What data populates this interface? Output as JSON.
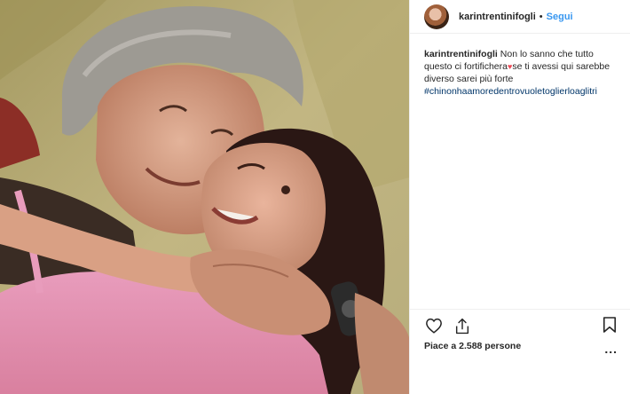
{
  "header": {
    "username": "karintrentinifogli",
    "separator": "•",
    "follow_label": "Segui"
  },
  "caption": {
    "username": "karintrentinifogli",
    "text_part1": "Non lo sanno che tutto questo ci fortifichera",
    "emoji": "♥",
    "text_part2": "se ti avessi qui sarebbe diverso sarei più forte",
    "hashtag": "#chinonhaamoredentrovuoletoglierloaglitri"
  },
  "actions": {
    "likes_text": "Piace a 2.588 persone",
    "more_label": "..."
  },
  "icons": {
    "like": "heart-outline-icon",
    "share": "share-upload-icon",
    "save": "bookmark-icon",
    "more": "more-options-icon"
  },
  "colors": {
    "link_blue": "#3897f0",
    "hashtag_blue": "#003569",
    "text": "#262626",
    "divider": "#efefef",
    "heart_red": "#ed4956"
  }
}
